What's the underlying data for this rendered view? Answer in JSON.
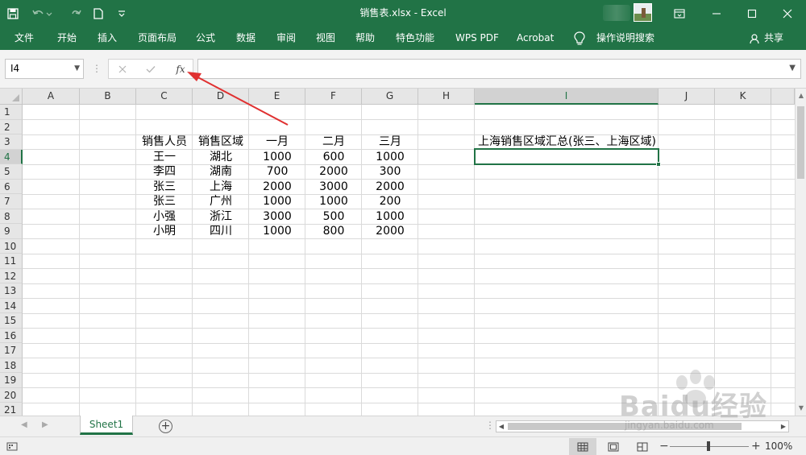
{
  "window": {
    "title": "销售表.xlsx  -  Excel",
    "accent_color": "#217346",
    "annotation_color": "#e03030"
  },
  "ribbon": {
    "tabs": [
      "文件",
      "开始",
      "插入",
      "页面布局",
      "公式",
      "数据",
      "审阅",
      "视图",
      "帮助",
      "特色功能",
      "WPS PDF",
      "Acrobat"
    ],
    "tell_me": "操作说明搜索",
    "share": "共享"
  },
  "formula_bar": {
    "name_box": "I4",
    "fx_label": "fx",
    "formula": ""
  },
  "grid": {
    "columns": [
      "A",
      "B",
      "C",
      "D",
      "E",
      "F",
      "G",
      "H",
      "I",
      "J",
      "K"
    ],
    "rows": [
      "1",
      "2",
      "3",
      "4",
      "5",
      "6",
      "7",
      "8",
      "9",
      "10",
      "11",
      "12",
      "13",
      "14",
      "15",
      "16",
      "17",
      "18",
      "19",
      "20",
      "21"
    ],
    "selected_column": "I",
    "selected_row": "4",
    "table": {
      "headers": [
        "销售人员",
        "销售区域",
        "一月",
        "二月",
        "三月"
      ],
      "rows": [
        [
          "王一",
          "湖北",
          "1000",
          "600",
          "1000"
        ],
        [
          "李四",
          "湖南",
          "700",
          "2000",
          "300"
        ],
        [
          "张三",
          "上海",
          "2000",
          "3000",
          "2000"
        ],
        [
          "张三",
          "广州",
          "1000",
          "1000",
          "200"
        ],
        [
          "小强",
          "浙江",
          "3000",
          "500",
          "1000"
        ],
        [
          "小明",
          "四川",
          "1000",
          "800",
          "2000"
        ]
      ]
    },
    "i3_text": "上海销售区域汇总(张三、上海区域)"
  },
  "sheets": {
    "active": "Sheet1"
  },
  "status": {
    "zoom": "100%"
  },
  "watermark": {
    "text": "Baidu经验",
    "sub": "jingyan.baidu.com"
  }
}
